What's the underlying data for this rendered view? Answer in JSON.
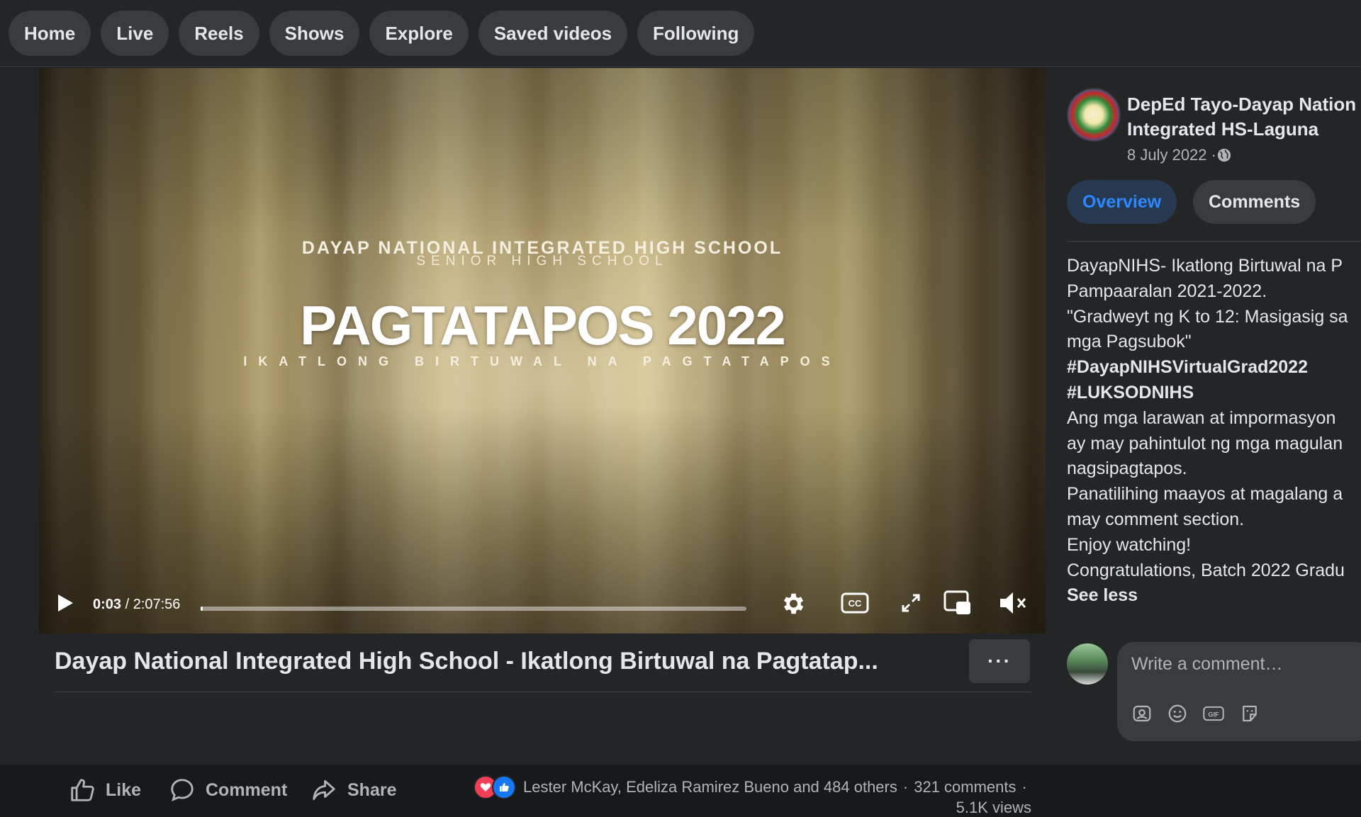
{
  "nav": {
    "tabs": [
      "Home",
      "Live",
      "Reels",
      "Shows",
      "Explore",
      "Saved videos",
      "Following"
    ]
  },
  "video": {
    "line1": "DAYAP NATIONAL INTEGRATED HIGH SCHOOL",
    "line2": "SENIOR HIGH SCHOOL",
    "headline": "PAGTATAPOS 2022",
    "subline": "IKATLONG BIRTUWAL NA PAGTATAPOS",
    "current_time": "0:03",
    "separator": " / ",
    "duration": "2:07:56",
    "progress_fraction": 0.004
  },
  "post": {
    "title": "Dayap National Integrated High School - Ikatlong Birtuwal na Pagtatap...",
    "more": "···",
    "actions": {
      "like": "Like",
      "comment": "Comment",
      "share": "Share"
    },
    "reactions_text": "Lester McKay, Edeliza Ramirez Bueno and 484 others",
    "comments_count": "321 comments",
    "views": "5.1K views"
  },
  "page": {
    "name_line1": "DepEd Tayo-Dayap Nation",
    "name_line2": "Integrated HS-Laguna",
    "date": "8 July 2022 · ",
    "tabs": {
      "overview": "Overview",
      "comments": "Comments"
    }
  },
  "description": {
    "lines": [
      "DayapNIHS- Ikatlong Birtuwal na P",
      "Pampaaralan 2021-2022.",
      "\"Gradweyt ng K to 12: Masigasig sa",
      "mga Pagsubok\"",
      "#DayapNIHSVirtualGrad2022",
      "#LUKSODNIHS",
      "Ang mga larawan at impormasyon",
      "ay may pahintulot ng mga magulan",
      "nagsipagtapos.",
      "Panatilihing maayos at magalang a",
      "may comment section.",
      "Enjoy watching!",
      "Congratulations, Batch 2022 Gradu"
    ],
    "see_less": "See less"
  },
  "comment": {
    "placeholder": "Write a comment…"
  },
  "colors": {
    "accent": "#2d88ff",
    "background": "#242526",
    "surface": "#3a3b3c",
    "text": "#e4e6eb",
    "muted": "#b0b3b8"
  }
}
